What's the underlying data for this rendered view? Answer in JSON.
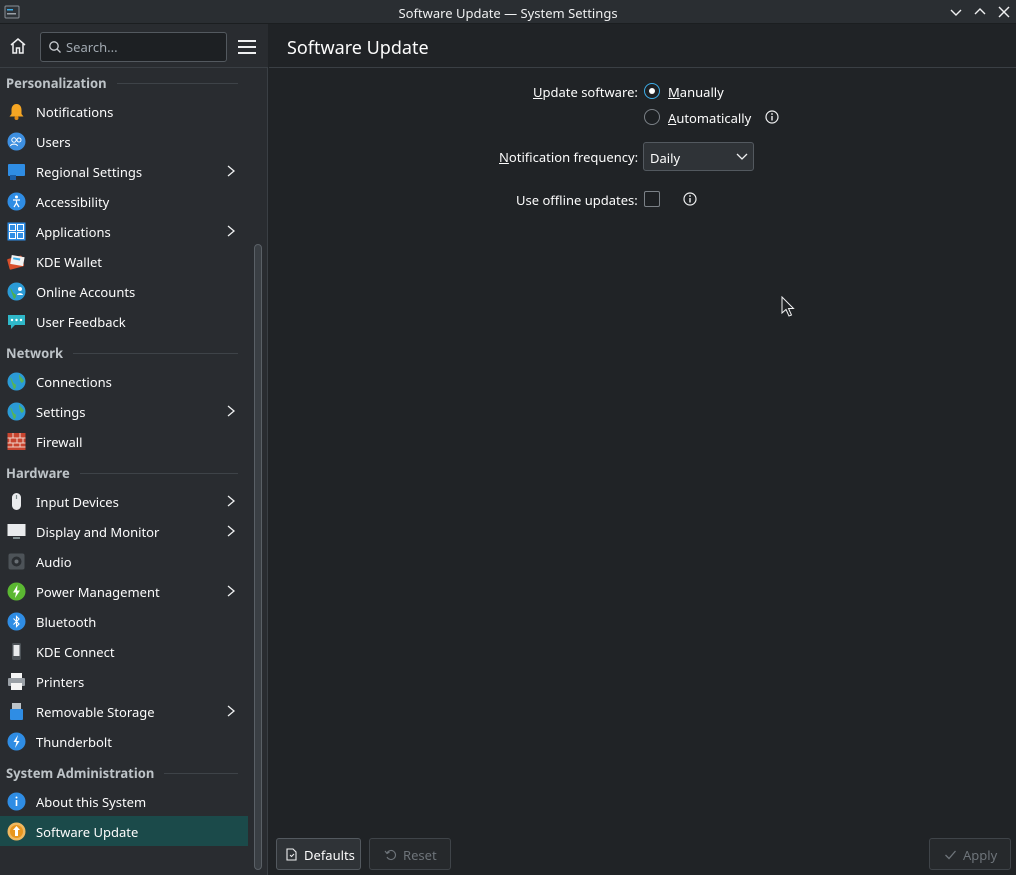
{
  "window": {
    "title": "Software Update — System Settings"
  },
  "sidebar": {
    "search_placeholder": "Search...",
    "sections": [
      {
        "title": "Personalization",
        "items": [
          {
            "label": "Notifications",
            "icon": "bell-icon",
            "submenu": false
          },
          {
            "label": "Users",
            "icon": "users-icon",
            "submenu": false
          },
          {
            "label": "Regional Settings",
            "icon": "regional-settings-icon",
            "submenu": true
          },
          {
            "label": "Accessibility",
            "icon": "accessibility-icon",
            "submenu": false
          },
          {
            "label": "Applications",
            "icon": "applications-icon",
            "submenu": true
          },
          {
            "label": "KDE Wallet",
            "icon": "wallet-icon",
            "submenu": false
          },
          {
            "label": "Online Accounts",
            "icon": "online-accounts-icon",
            "submenu": false
          },
          {
            "label": "User Feedback",
            "icon": "feedback-icon",
            "submenu": false
          }
        ]
      },
      {
        "title": "Network",
        "items": [
          {
            "label": "Connections",
            "icon": "globe-icon",
            "submenu": false
          },
          {
            "label": "Settings",
            "icon": "globe-settings-icon",
            "submenu": true
          },
          {
            "label": "Firewall",
            "icon": "firewall-icon",
            "submenu": false
          }
        ]
      },
      {
        "title": "Hardware",
        "items": [
          {
            "label": "Input Devices",
            "icon": "mouse-icon",
            "submenu": true
          },
          {
            "label": "Display and Monitor",
            "icon": "monitor-icon",
            "submenu": true
          },
          {
            "label": "Audio",
            "icon": "speaker-icon",
            "submenu": false
          },
          {
            "label": "Power Management",
            "icon": "power-icon",
            "submenu": true
          },
          {
            "label": "Bluetooth",
            "icon": "bluetooth-icon",
            "submenu": false
          },
          {
            "label": "KDE Connect",
            "icon": "phone-icon",
            "submenu": false
          },
          {
            "label": "Printers",
            "icon": "printer-icon",
            "submenu": false
          },
          {
            "label": "Removable Storage",
            "icon": "usb-icon",
            "submenu": true
          },
          {
            "label": "Thunderbolt",
            "icon": "thunderbolt-icon",
            "submenu": false
          }
        ]
      },
      {
        "title": "System Administration",
        "items": [
          {
            "label": "About this System",
            "icon": "info-icon",
            "submenu": false
          },
          {
            "label": "Software Update",
            "icon": "update-icon",
            "submenu": false,
            "selected": true
          }
        ]
      }
    ]
  },
  "main": {
    "title": "Software Update",
    "update_software": {
      "label_u": "U",
      "label_rest": "pdate software:",
      "manually_u": "M",
      "manually_rest": "anually",
      "automatically_u": "A",
      "automatically_rest": "utomatically",
      "selected": "Manually"
    },
    "notification_frequency": {
      "label_u": "N",
      "label_rest": "otification frequency:",
      "value": "Daily"
    },
    "offline_updates": {
      "label": "Use offline updates:",
      "checked": false
    }
  },
  "footer": {
    "defaults_label": "Defaults",
    "reset_label": "Reset",
    "apply_label": "Apply"
  },
  "colors": {
    "accent": "#3daee9",
    "selection": "#1b4a4a",
    "background": "#202326"
  }
}
